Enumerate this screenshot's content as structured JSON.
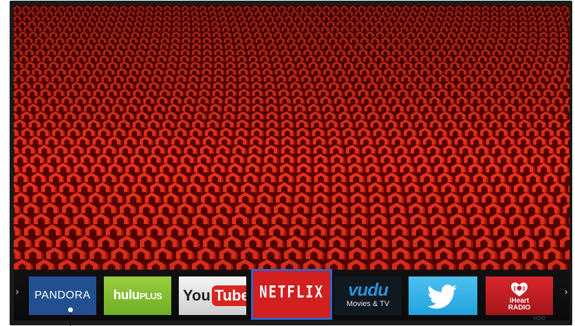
{
  "screen": {
    "wallpaper_colors": {
      "base": "#5a0000",
      "pattern_light": "#e8321c",
      "pattern_mid": "#b3140b",
      "pattern_dark": "#3a0000"
    }
  },
  "app_bar": {
    "left_arrow": "›",
    "right_arrow": "›",
    "apps": [
      {
        "id": "pandora",
        "label": "PANDORA",
        "color": "#224f8f"
      },
      {
        "id": "hulu",
        "label": "hulu",
        "label_suffix": "PLUS",
        "color": "#82bd2e"
      },
      {
        "id": "youtube",
        "label_1": "You",
        "label_2": "Tube",
        "color": "#d8261f"
      },
      {
        "id": "netflix",
        "label": "NETFLIX",
        "color": "#d21f1f",
        "selected": true
      },
      {
        "id": "vudu",
        "label": "vudu",
        "sub": "Movies & TV",
        "color": "#101820"
      },
      {
        "id": "twitter",
        "icon": "bird-icon",
        "color": "#2daee6"
      },
      {
        "id": "iheart",
        "line1": "iHeart",
        "line2": "RADIO",
        "icon": "heart-radio-icon",
        "color": "#c11e24"
      }
    ]
  },
  "bezel": {
    "brand": "VIZIO"
  }
}
